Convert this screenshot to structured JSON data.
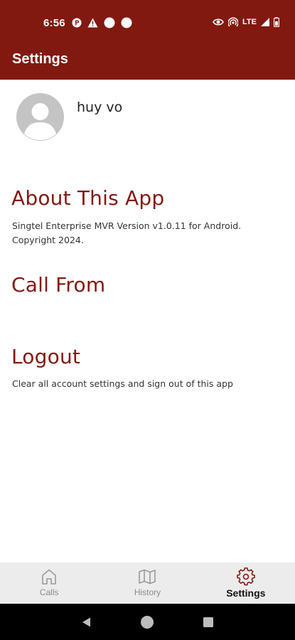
{
  "status_bar": {
    "time": "6:56",
    "network": "LTE",
    "left_icons": [
      "p-circle-icon",
      "warning-icon",
      "dot-icon",
      "dot-icon"
    ],
    "right_icons": [
      "eye-icon",
      "hotspot-icon",
      "lte-label",
      "signal-icon",
      "battery-icon"
    ]
  },
  "app_bar": {
    "title": "Settings"
  },
  "profile": {
    "name": "huy vo"
  },
  "sections": {
    "about": {
      "title": "About This App",
      "description": "Singtel Enterprise MVR Version v1.0.11 for Android. Copyright 2024."
    },
    "call_from": {
      "title": "Call From"
    },
    "logout": {
      "title": "Logout",
      "description": "Clear all account settings and sign out of this app"
    }
  },
  "bottom_nav": {
    "items": [
      {
        "label": "Calls",
        "icon": "home-icon"
      },
      {
        "label": "History",
        "icon": "map-icon"
      },
      {
        "label": "Settings",
        "icon": "gear-icon",
        "active": true
      }
    ]
  },
  "colors": {
    "primary": "#821911",
    "nav_background": "#ececec",
    "inactive": "#8a8a8a"
  }
}
